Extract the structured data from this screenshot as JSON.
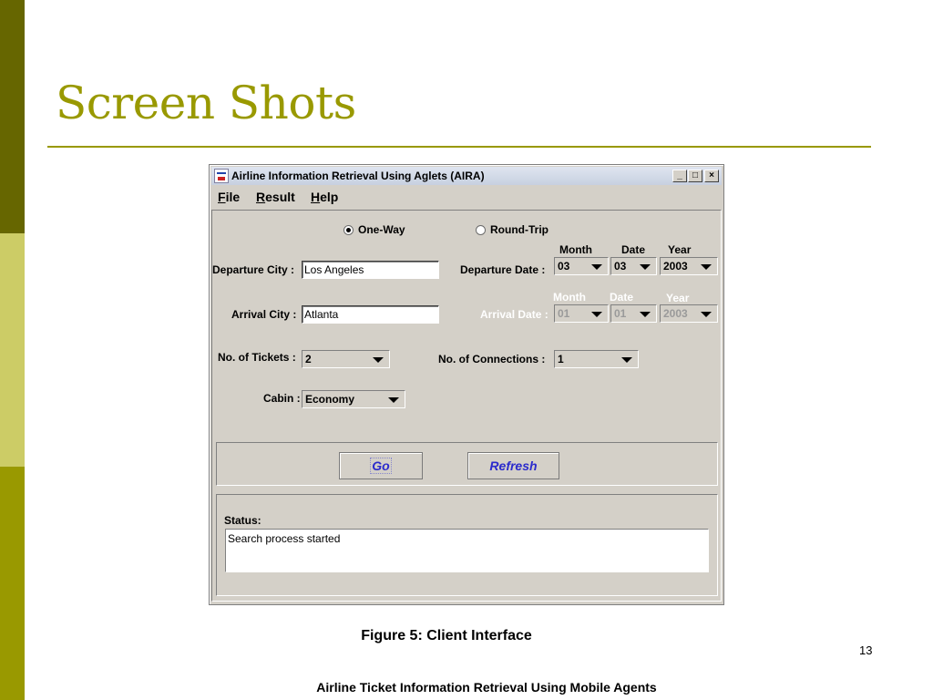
{
  "slide": {
    "title": "Screen Shots",
    "caption": "Figure 5: Client Interface",
    "page_number": "13",
    "footer": "Airline Ticket Information Retrieval Using Mobile Agents",
    "colors": {
      "accent": "#999900",
      "bar_dark": "#666600",
      "bar_light": "#cccc66"
    }
  },
  "window": {
    "title": "Airline Information Retrieval Using Aglets (AIRA)",
    "icon": "app-icon",
    "controls": {
      "minimize": "_",
      "maximize": "□",
      "close": "×"
    }
  },
  "menu": {
    "file": {
      "mnemonic": "F",
      "rest": "ile"
    },
    "result": {
      "mnemonic": "R",
      "rest": "esult"
    },
    "help": {
      "mnemonic": "H",
      "rest": "elp"
    }
  },
  "form": {
    "trip_type": {
      "one_way": "One-Way",
      "round_trip": "Round-Trip",
      "selected": "One-Way"
    },
    "departure_city": {
      "label": "Departure City :",
      "value": "Los Angeles"
    },
    "arrival_city": {
      "label": "Arrival City :",
      "value": "Atlanta"
    },
    "departure_date": {
      "label": "Departure Date :",
      "month_label": "Month",
      "date_label": "Date",
      "year_label": "Year",
      "month": "03",
      "date": "03",
      "year": "2003"
    },
    "arrival_date": {
      "label": "Arrival Date :",
      "month_label": "Month",
      "date_label": "Date",
      "year_label": "Year",
      "month": "01",
      "date": "01",
      "year": "2003",
      "enabled": false
    },
    "tickets": {
      "label": "No. of Tickets :",
      "value": "2"
    },
    "connections": {
      "label": "No. of Connections :",
      "value": "1"
    },
    "cabin": {
      "label": "Cabin :",
      "value": "Economy"
    }
  },
  "buttons": {
    "go": "Go",
    "refresh": "Refresh"
  },
  "status": {
    "label": "Status:",
    "text": "Search process started"
  }
}
